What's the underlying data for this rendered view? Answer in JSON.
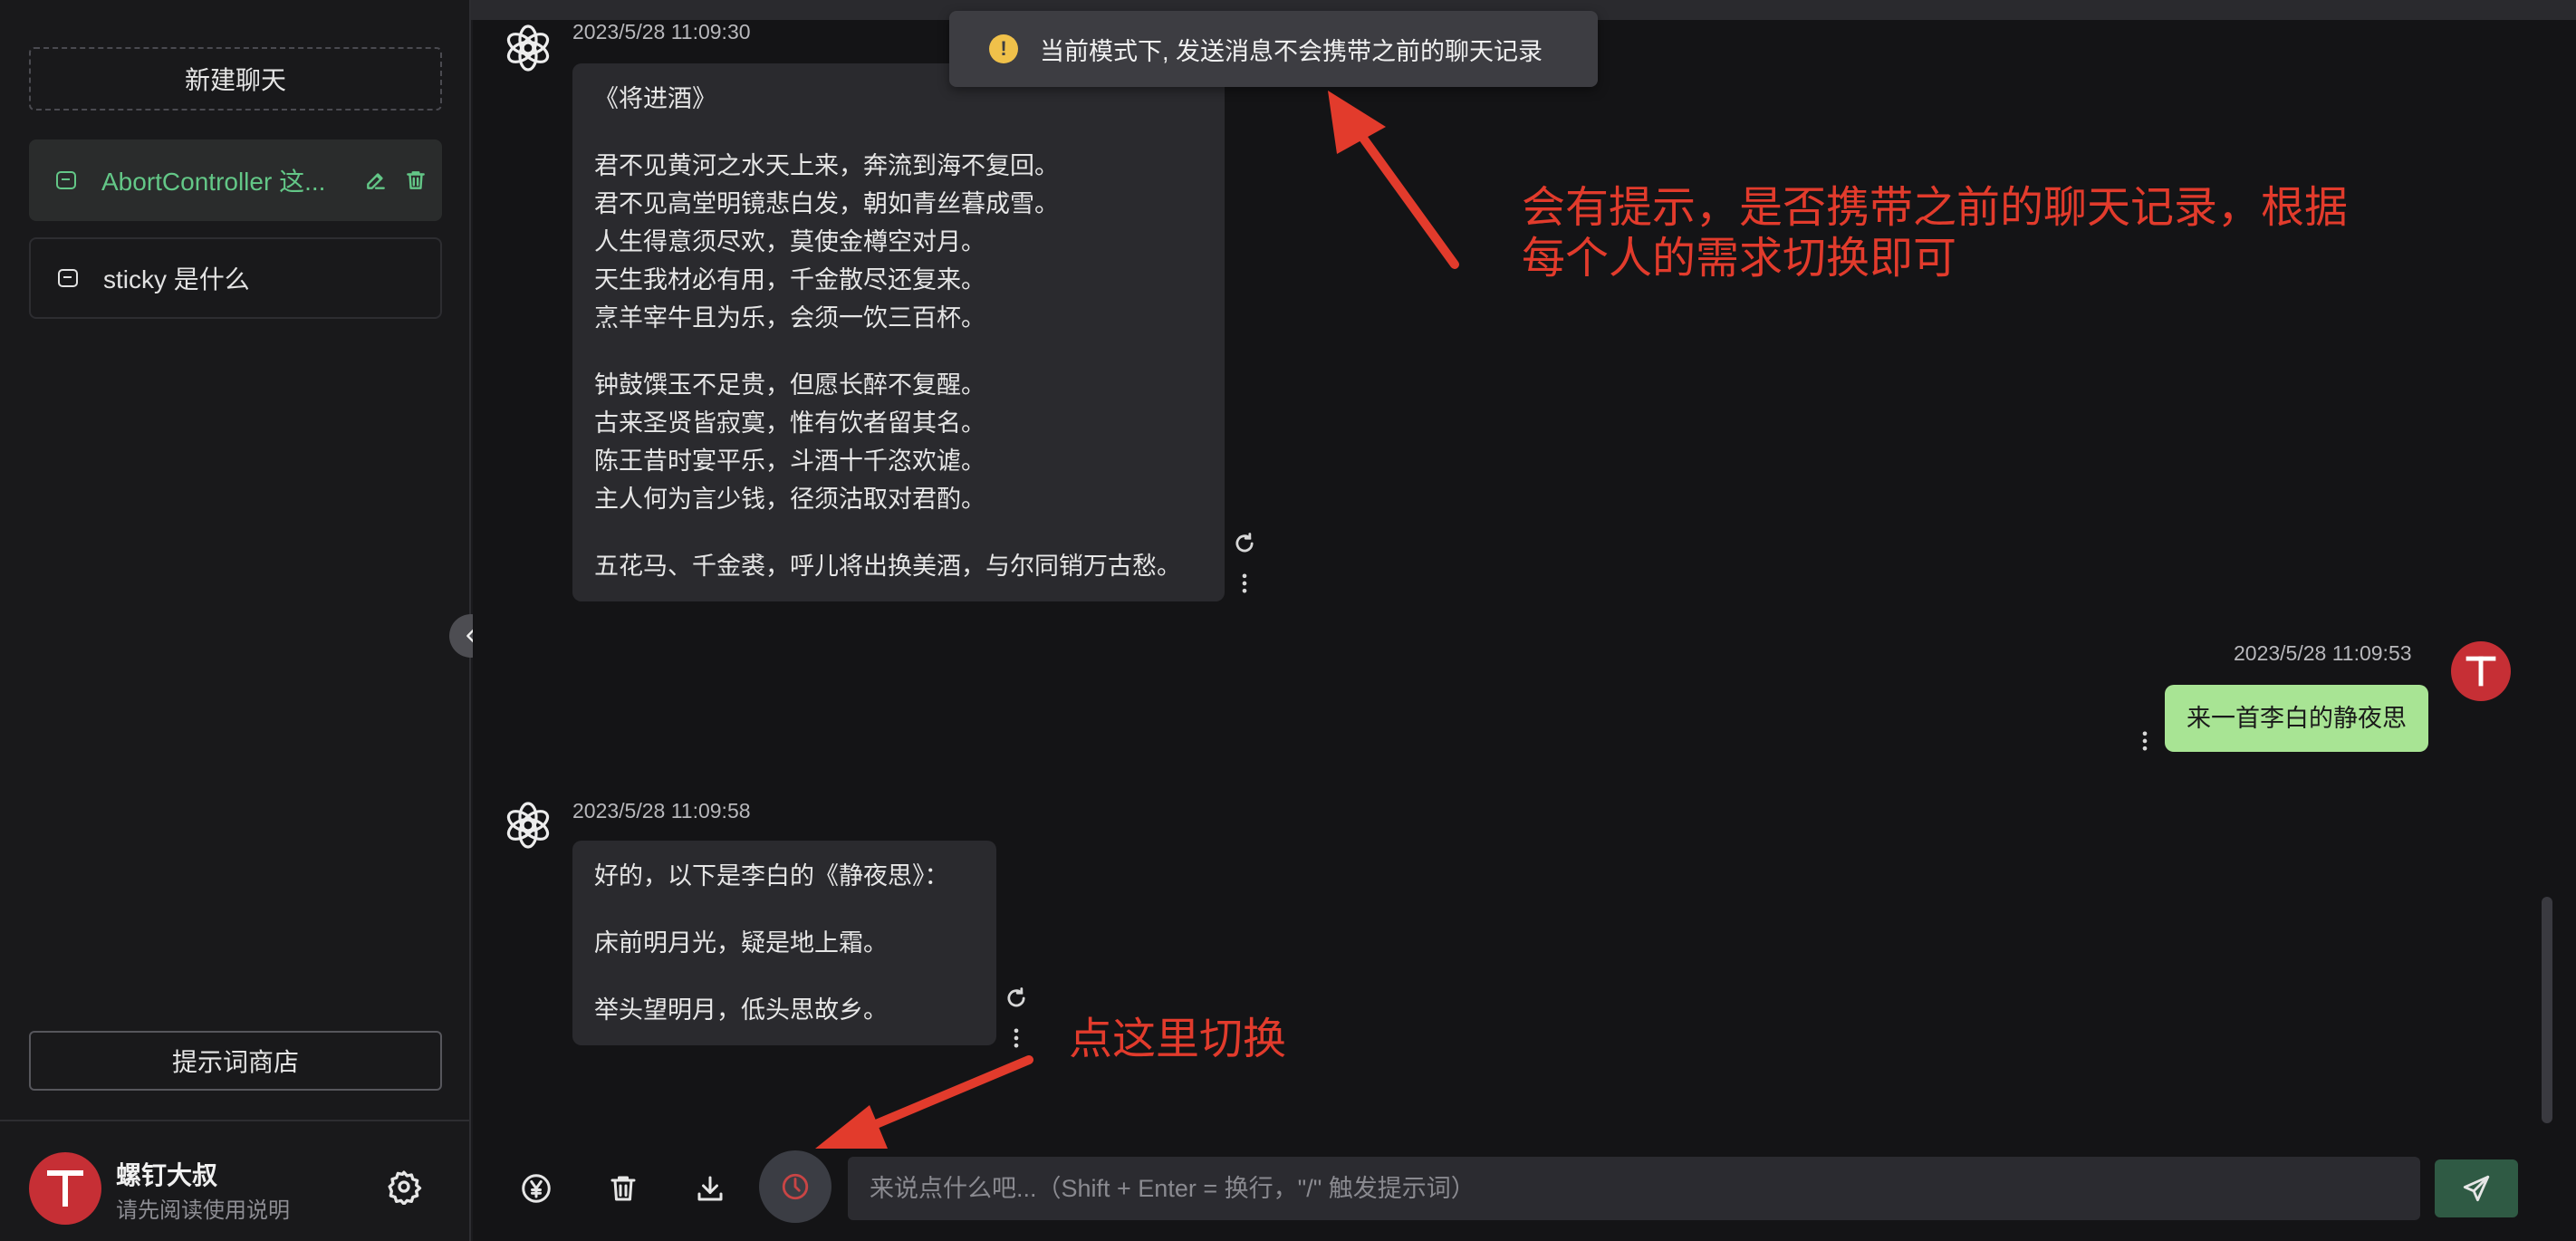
{
  "sidebar": {
    "new_chat_label": "新建聊天",
    "chats": [
      {
        "label": "AbortController 这...",
        "active": true
      },
      {
        "label": "sticky 是什么",
        "active": false
      }
    ],
    "prompt_store_label": "提示词商店",
    "user": {
      "name": "螺钉大叔",
      "subtitle": "请先阅读使用说明",
      "avatar_letter": "T"
    }
  },
  "toast": {
    "text": "当前模式下, 发送消息不会携带之前的聊天记录"
  },
  "messages": [
    {
      "role": "assistant",
      "timestamp": "2023/5/28 11:09:30",
      "paragraphs": [
        [
          "《将进酒》"
        ],
        [
          "君不见黄河之水天上来，奔流到海不复回。",
          "君不见高堂明镜悲白发，朝如青丝暮成雪。",
          "人生得意须尽欢，莫使金樽空对月。",
          "天生我材必有用，千金散尽还复来。",
          "烹羊宰牛且为乐，会须一饮三百杯。"
        ],
        [
          "钟鼓馔玉不足贵，但愿长醉不复醒。",
          "古来圣贤皆寂寞，惟有饮者留其名。",
          "陈王昔时宴平乐，斗酒十千恣欢谑。",
          "主人何为言少钱，径须沽取对君酌。"
        ],
        [
          "五花马、千金裘，呼儿将出换美酒，与尔同销万古愁。"
        ]
      ]
    },
    {
      "role": "user",
      "timestamp": "2023/5/28 11:09:53",
      "text": "来一首李白的静夜思"
    },
    {
      "role": "assistant",
      "timestamp": "2023/5/28 11:09:58",
      "paragraphs": [
        [
          "好的，以下是李白的《静夜思》："
        ],
        [
          "床前明月光，疑是地上霜。"
        ],
        [
          "举头望明月，低头思故乡。"
        ]
      ]
    }
  ],
  "annotations": {
    "top_line1": "会有提示，是否携带之前的聊天记录，根据",
    "top_line2": "每个人的需求切换即可",
    "bottom": "点这里切换",
    "color": "#e23b2c"
  },
  "input": {
    "placeholder": "来说点什么吧...（Shift + Enter = 换行，\"/\" 触发提示词）"
  },
  "icons": {
    "toolbar": [
      "yuan-icon",
      "trash-icon",
      "download-icon",
      "context-toggle-icon"
    ],
    "send": "send-icon"
  },
  "colors": {
    "accent_green": "#63c787",
    "user_bubble": "#a8e494",
    "avatar_red": "#c62f35",
    "warning_yellow": "#f0c14a"
  }
}
